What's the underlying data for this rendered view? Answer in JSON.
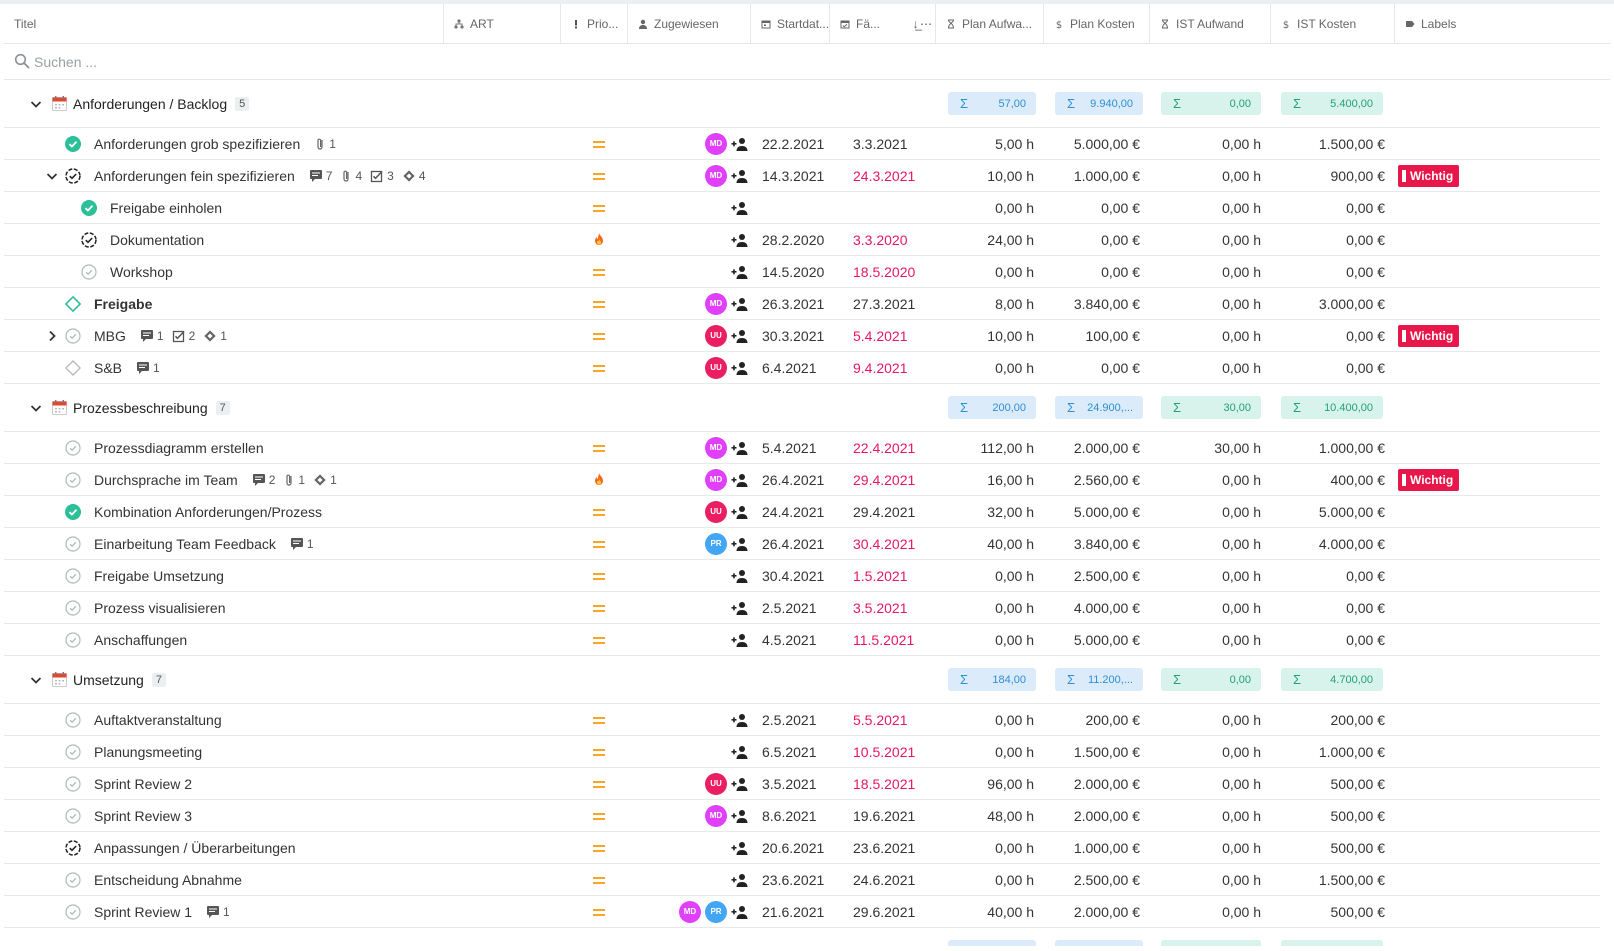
{
  "columns": [
    {
      "key": "title",
      "label": "Titel",
      "icon": "none"
    },
    {
      "key": "art",
      "label": "ART",
      "icon": "sitemap-icon"
    },
    {
      "key": "prio",
      "label": "Prio...",
      "icon": "exclamation-icon"
    },
    {
      "key": "assigned",
      "label": "Zugewiesen",
      "icon": "user-icon"
    },
    {
      "key": "start",
      "label": "Startdat...",
      "icon": "calendar-icon"
    },
    {
      "key": "due",
      "label": "Fä...",
      "icon": "calendar-check-icon"
    },
    {
      "key": "plan_effort",
      "label": "Plan Aufwa...",
      "icon": "hourglass-icon"
    },
    {
      "key": "plan_cost",
      "label": "Plan Kosten",
      "icon": "dollar-icon"
    },
    {
      "key": "ist_effort",
      "label": "IST Aufwand",
      "icon": "hourglass-icon"
    },
    {
      "key": "ist_cost",
      "label": "IST Kosten",
      "icon": "dollar-icon"
    },
    {
      "key": "labels",
      "label": "Labels",
      "icon": "tag-icon"
    }
  ],
  "search": {
    "placeholder": "Suchen ..."
  },
  "colors": {
    "accent_blue": "#2b8fd6",
    "accent_green": "#22a07a",
    "due_red": "#e8175d",
    "label_red": "#e8174a",
    "prio_orange": "#f5a623",
    "avatar_md": "#e040fb",
    "avatar_uu": "#e91e63",
    "avatar_pr": "#42a5f5"
  },
  "groups": [
    {
      "name": "Anforderungen / Backlog",
      "count": "5",
      "sums": {
        "plan_effort": "57,00",
        "plan_cost": "9.940,00",
        "ist_effort": "0,00",
        "ist_cost": "5.400,00"
      },
      "rows": [
        {
          "title": "Anforderungen grob spezifizieren",
          "status": "done",
          "level": 0,
          "expand": "none",
          "bold": false,
          "meta": [
            {
              "icon": "paperclip-icon",
              "n": "1"
            }
          ],
          "prio": "medium",
          "avatars": [
            "MD"
          ],
          "start": "22.2.2021",
          "due": "3.3.2021",
          "due_overdue": false,
          "plan_effort": "5,00 h",
          "plan_cost": "5.000,00 €",
          "ist_effort": "0,00 h",
          "ist_cost": "1.500,00 €",
          "label": ""
        },
        {
          "title": "Anforderungen fein spezifizieren",
          "status": "progress",
          "level": 0,
          "expand": "open",
          "bold": false,
          "meta": [
            {
              "icon": "comment-icon",
              "n": "7"
            },
            {
              "icon": "paperclip-icon",
              "n": "4"
            },
            {
              "icon": "checkbox-icon",
              "n": "3"
            },
            {
              "icon": "diamond-icon",
              "n": "4"
            }
          ],
          "prio": "medium",
          "avatars": [
            "MD"
          ],
          "start": "14.3.2021",
          "due": "24.3.2021",
          "due_overdue": true,
          "plan_effort": "10,00 h",
          "plan_cost": "1.000,00 €",
          "ist_effort": "0,00 h",
          "ist_cost": "900,00 €",
          "label": "Wichtig"
        },
        {
          "title": "Freigabe einholen",
          "status": "done",
          "level": 1,
          "expand": "none",
          "bold": false,
          "meta": [],
          "prio": "medium",
          "avatars": [],
          "start": "",
          "due": "",
          "due_overdue": false,
          "plan_effort": "0,00 h",
          "plan_cost": "0,00 €",
          "ist_effort": "0,00 h",
          "ist_cost": "0,00 €",
          "label": ""
        },
        {
          "title": "Dokumentation",
          "status": "progress",
          "level": 1,
          "expand": "none",
          "bold": false,
          "meta": [],
          "prio": "high",
          "avatars": [],
          "start": "28.2.2020",
          "due": "3.3.2020",
          "due_overdue": true,
          "plan_effort": "24,00 h",
          "plan_cost": "0,00 €",
          "ist_effort": "0,00 h",
          "ist_cost": "0,00 €",
          "label": ""
        },
        {
          "title": "Workshop",
          "status": "open",
          "level": 1,
          "expand": "none",
          "bold": false,
          "meta": [],
          "prio": "medium",
          "avatars": [],
          "start": "14.5.2020",
          "due": "18.5.2020",
          "due_overdue": true,
          "plan_effort": "0,00 h",
          "plan_cost": "0,00 €",
          "ist_effort": "0,00 h",
          "ist_cost": "0,00 €",
          "label": ""
        },
        {
          "title": "Freigabe",
          "status": "milestone-active",
          "level": 0,
          "expand": "none",
          "bold": true,
          "meta": [],
          "prio": "medium",
          "avatars": [
            "MD"
          ],
          "start": "26.3.2021",
          "due": "27.3.2021",
          "due_overdue": false,
          "plan_effort": "8,00 h",
          "plan_cost": "3.840,00 €",
          "ist_effort": "0,00 h",
          "ist_cost": "3.000,00 €",
          "label": ""
        },
        {
          "title": "MBG",
          "status": "open",
          "level": 0,
          "expand": "closed",
          "bold": false,
          "meta": [
            {
              "icon": "comment-icon",
              "n": "1"
            },
            {
              "icon": "checkbox-icon",
              "n": "2"
            },
            {
              "icon": "diamond-icon",
              "n": "1"
            }
          ],
          "prio": "medium",
          "avatars": [
            "UU"
          ],
          "start": "30.3.2021",
          "due": "5.4.2021",
          "due_overdue": true,
          "plan_effort": "10,00 h",
          "plan_cost": "100,00 €",
          "ist_effort": "0,00 h",
          "ist_cost": "0,00 €",
          "label": "Wichtig"
        },
        {
          "title": "S&B",
          "status": "milestone",
          "level": 0,
          "expand": "none",
          "bold": false,
          "meta": [
            {
              "icon": "comment-icon",
              "n": "1"
            }
          ],
          "prio": "medium",
          "avatars": [
            "UU"
          ],
          "start": "6.4.2021",
          "due": "9.4.2021",
          "due_overdue": true,
          "plan_effort": "0,00 h",
          "plan_cost": "0,00 €",
          "ist_effort": "0,00 h",
          "ist_cost": "0,00 €",
          "label": ""
        }
      ]
    },
    {
      "name": "Prozessbeschreibung",
      "count": "7",
      "sums": {
        "plan_effort": "200,00",
        "plan_cost": "24.900,...",
        "ist_effort": "30,00",
        "ist_cost": "10.400,00"
      },
      "rows": [
        {
          "title": "Prozessdiagramm erstellen",
          "status": "open",
          "level": 0,
          "expand": "none",
          "bold": false,
          "meta": [],
          "prio": "medium",
          "avatars": [
            "MD"
          ],
          "start": "5.4.2021",
          "due": "22.4.2021",
          "due_overdue": true,
          "plan_effort": "112,00 h",
          "plan_cost": "2.000,00 €",
          "ist_effort": "30,00 h",
          "ist_cost": "1.000,00 €",
          "label": ""
        },
        {
          "title": "Durchsprache im Team",
          "status": "open",
          "level": 0,
          "expand": "none",
          "bold": false,
          "meta": [
            {
              "icon": "comment-icon",
              "n": "2"
            },
            {
              "icon": "paperclip-icon",
              "n": "1"
            },
            {
              "icon": "diamond-icon",
              "n": "1"
            }
          ],
          "prio": "high",
          "avatars": [
            "MD"
          ],
          "start": "26.4.2021",
          "due": "29.4.2021",
          "due_overdue": true,
          "plan_effort": "16,00 h",
          "plan_cost": "2.560,00 €",
          "ist_effort": "0,00 h",
          "ist_cost": "400,00 €",
          "label": "Wichtig"
        },
        {
          "title": "Kombination Anforderungen/Prozess",
          "status": "done",
          "level": 0,
          "expand": "none",
          "bold": false,
          "meta": [],
          "prio": "medium",
          "avatars": [
            "UU"
          ],
          "start": "24.4.2021",
          "due": "29.4.2021",
          "due_overdue": false,
          "plan_effort": "32,00 h",
          "plan_cost": "5.000,00 €",
          "ist_effort": "0,00 h",
          "ist_cost": "5.000,00 €",
          "label": ""
        },
        {
          "title": "Einarbeitung Team Feedback",
          "status": "open",
          "level": 0,
          "expand": "none",
          "bold": false,
          "meta": [
            {
              "icon": "comment-icon",
              "n": "1"
            }
          ],
          "prio": "medium",
          "avatars": [
            "PR"
          ],
          "start": "26.4.2021",
          "due": "30.4.2021",
          "due_overdue": true,
          "plan_effort": "40,00 h",
          "plan_cost": "3.840,00 €",
          "ist_effort": "0,00 h",
          "ist_cost": "4.000,00 €",
          "label": ""
        },
        {
          "title": "Freigabe Umsetzung",
          "status": "open",
          "level": 0,
          "expand": "none",
          "bold": false,
          "meta": [],
          "prio": "medium",
          "avatars": [],
          "start": "30.4.2021",
          "due": "1.5.2021",
          "due_overdue": true,
          "plan_effort": "0,00 h",
          "plan_cost": "2.500,00 €",
          "ist_effort": "0,00 h",
          "ist_cost": "0,00 €",
          "label": ""
        },
        {
          "title": "Prozess visualisieren",
          "status": "open",
          "level": 0,
          "expand": "none",
          "bold": false,
          "meta": [],
          "prio": "medium",
          "avatars": [],
          "start": "2.5.2021",
          "due": "3.5.2021",
          "due_overdue": true,
          "plan_effort": "0,00 h",
          "plan_cost": "4.000,00 €",
          "ist_effort": "0,00 h",
          "ist_cost": "0,00 €",
          "label": ""
        },
        {
          "title": "Anschaffungen",
          "status": "open",
          "level": 0,
          "expand": "none",
          "bold": false,
          "meta": [],
          "prio": "medium",
          "avatars": [],
          "start": "4.5.2021",
          "due": "11.5.2021",
          "due_overdue": true,
          "plan_effort": "0,00 h",
          "plan_cost": "5.000,00 €",
          "ist_effort": "0,00 h",
          "ist_cost": "0,00 €",
          "label": ""
        }
      ]
    },
    {
      "name": "Umsetzung",
      "count": "7",
      "sums": {
        "plan_effort": "184,00",
        "plan_cost": "11.200,...",
        "ist_effort": "0,00",
        "ist_cost": "4.700,00"
      },
      "rows": [
        {
          "title": "Auftaktveranstaltung",
          "status": "open",
          "level": 0,
          "expand": "none",
          "bold": false,
          "meta": [],
          "prio": "medium",
          "avatars": [],
          "start": "2.5.2021",
          "due": "5.5.2021",
          "due_overdue": true,
          "plan_effort": "0,00 h",
          "plan_cost": "200,00 €",
          "ist_effort": "0,00 h",
          "ist_cost": "200,00 €",
          "label": ""
        },
        {
          "title": "Planungsmeeting",
          "status": "open",
          "level": 0,
          "expand": "none",
          "bold": false,
          "meta": [],
          "prio": "medium",
          "avatars": [],
          "start": "6.5.2021",
          "due": "10.5.2021",
          "due_overdue": true,
          "plan_effort": "0,00 h",
          "plan_cost": "1.500,00 €",
          "ist_effort": "0,00 h",
          "ist_cost": "1.000,00 €",
          "label": ""
        },
        {
          "title": "Sprint Review 2",
          "status": "open",
          "level": 0,
          "expand": "none",
          "bold": false,
          "meta": [],
          "prio": "medium",
          "avatars": [
            "UU"
          ],
          "start": "3.5.2021",
          "due": "18.5.2021",
          "due_overdue": true,
          "plan_effort": "96,00 h",
          "plan_cost": "2.000,00 €",
          "ist_effort": "0,00 h",
          "ist_cost": "500,00 €",
          "label": ""
        },
        {
          "title": "Sprint Review 3",
          "status": "open",
          "level": 0,
          "expand": "none",
          "bold": false,
          "meta": [],
          "prio": "medium",
          "avatars": [
            "MD"
          ],
          "start": "8.6.2021",
          "due": "19.6.2021",
          "due_overdue": false,
          "plan_effort": "48,00 h",
          "plan_cost": "2.000,00 €",
          "ist_effort": "0,00 h",
          "ist_cost": "500,00 €",
          "label": ""
        },
        {
          "title": "Anpassungen / Überarbeitungen",
          "status": "progress",
          "level": 0,
          "expand": "none",
          "bold": false,
          "meta": [],
          "prio": "medium",
          "avatars": [],
          "start": "20.6.2021",
          "due": "23.6.2021",
          "due_overdue": false,
          "plan_effort": "0,00 h",
          "plan_cost": "1.000,00 €",
          "ist_effort": "0,00 h",
          "ist_cost": "500,00 €",
          "label": ""
        },
        {
          "title": "Entscheidung Abnahme",
          "status": "open",
          "level": 0,
          "expand": "none",
          "bold": false,
          "meta": [],
          "prio": "medium",
          "avatars": [],
          "start": "23.6.2021",
          "due": "24.6.2021",
          "due_overdue": false,
          "plan_effort": "0,00 h",
          "plan_cost": "2.500,00 €",
          "ist_effort": "0,00 h",
          "ist_cost": "1.500,00 €",
          "label": ""
        },
        {
          "title": "Sprint Review 1",
          "status": "open",
          "level": 0,
          "expand": "none",
          "bold": false,
          "meta": [
            {
              "icon": "comment-icon",
              "n": "1"
            }
          ],
          "prio": "medium",
          "avatars": [
            "MD",
            "PR"
          ],
          "start": "21.6.2021",
          "due": "29.6.2021",
          "due_overdue": false,
          "plan_effort": "40,00 h",
          "plan_cost": "2.000,00 €",
          "ist_effort": "0,00 h",
          "ist_cost": "500,00 €",
          "label": ""
        }
      ]
    }
  ]
}
